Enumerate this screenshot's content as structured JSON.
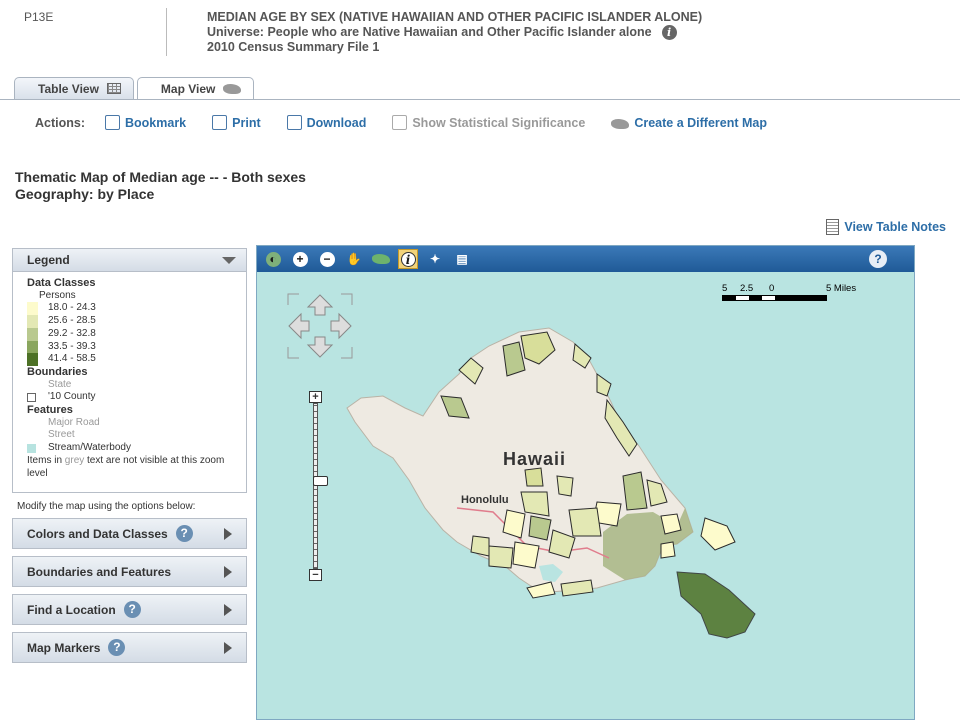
{
  "header": {
    "code": "P13E",
    "title_lines": [
      "MEDIAN AGE BY SEX (NATIVE HAWAIIAN AND OTHER PACIFIC ISLANDER ALONE)",
      "Universe: People who are Native Hawaiian and Other Pacific Islander alone",
      "2010 Census Summary File 1"
    ],
    "info_icon": "info-icon"
  },
  "tabs": [
    {
      "label": "Table View",
      "icon": "table-grid-icon",
      "active": false
    },
    {
      "label": "Map View",
      "icon": "us-map-icon",
      "active": true
    }
  ],
  "actions": {
    "label": "Actions:",
    "items": [
      {
        "label": "Bookmark",
        "icon": "bookmark-icon",
        "enabled": true
      },
      {
        "label": "Print",
        "icon": "print-icon",
        "enabled": true
      },
      {
        "label": "Download",
        "icon": "download-icon",
        "enabled": true
      },
      {
        "label": "Show Statistical Significance",
        "icon": "significance-icon",
        "enabled": false
      },
      {
        "label": "Create a Different Map",
        "icon": "us-map-icon",
        "enabled": true
      }
    ]
  },
  "map_title": {
    "line1": "Thematic Map of Median age -- - Both sexes",
    "line2": "Geography: by Place"
  },
  "view_table_notes": "View Table Notes",
  "legend": {
    "title": "Legend",
    "data_classes_label": "Data Classes",
    "unit": "Persons",
    "classes": [
      {
        "range": "18.0 - 24.3",
        "color": "#fdfbcc"
      },
      {
        "range": "25.6 - 28.5",
        "color": "#e3e8b4"
      },
      {
        "range": "29.2 - 32.8",
        "color": "#b9c98f"
      },
      {
        "range": "33.5 - 39.3",
        "color": "#8aa65e"
      },
      {
        "range": "41.4 - 58.5",
        "color": "#4d7126"
      }
    ],
    "boundaries_label": "Boundaries",
    "boundaries": [
      {
        "label": "State",
        "visible": false
      },
      {
        "label": "'10 County",
        "visible": true
      }
    ],
    "features_label": "Features",
    "features": [
      {
        "label": "Major Road",
        "visible": false
      },
      {
        "label": "Street",
        "visible": false
      },
      {
        "label": "Stream/Waterbody",
        "visible": true,
        "color": "#b7e3e0"
      }
    ],
    "note_pre": "Items in ",
    "note_grey": "grey",
    "note_post": " text are not visible at this zoom level"
  },
  "modify_text": "Modify the map using the options below:",
  "panels": [
    {
      "label": "Colors and Data Classes",
      "help": true
    },
    {
      "label": "Boundaries and Features",
      "help": false
    },
    {
      "label": "Find a Location",
      "help": true
    },
    {
      "label": "Map Markers",
      "help": true
    }
  ],
  "map": {
    "toolbar": [
      "globe-icon",
      "zoom-in-icon",
      "zoom-out-icon",
      "pan-hand-icon",
      "full-extent-icon",
      "identify-icon",
      "satellite-icon",
      "print-map-icon"
    ],
    "active_tool": "identify-icon",
    "help_label": "?",
    "scale_labels": [
      "5",
      "2.5",
      "0",
      "5 Miles"
    ],
    "zoom_plus": "+",
    "zoom_minus": "−",
    "zoom_level": 0.45,
    "labels": {
      "island": "Hawaii",
      "city": "Honolulu"
    },
    "water_color": "#b9e4e1",
    "land_color": "#eeeae2"
  }
}
